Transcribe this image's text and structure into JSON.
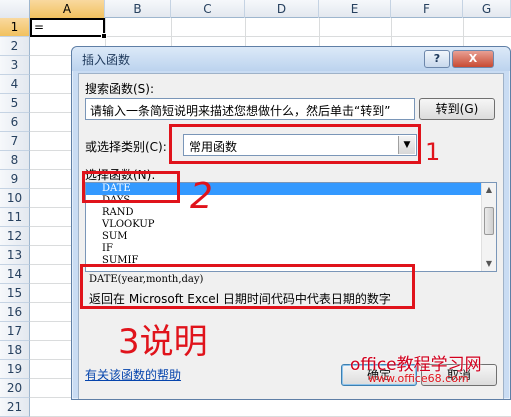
{
  "spreadsheet": {
    "columns": [
      "A",
      "B",
      "C",
      "D",
      "E",
      "F",
      "G"
    ],
    "rows": [
      "1",
      "2",
      "3",
      "4",
      "5",
      "6",
      "7",
      "8",
      "9",
      "10",
      "11",
      "12",
      "13",
      "14",
      "15",
      "16",
      "17",
      "18",
      "19",
      "20",
      "21"
    ],
    "active_cell_value": "="
  },
  "dialog": {
    "title": "插入函数",
    "help_button": "?",
    "close_button": "X",
    "search_label": "搜索函数(S):",
    "search_value": "请输入一条简短说明来描述您想做什么，然后单击“转到”",
    "goto_button": "转到(G)",
    "category_label": "或选择类别(C):",
    "category_value": "常用函数",
    "function_list_label": "选择函数(N):",
    "functions": [
      "DATE",
      "DAYS",
      "RAND",
      "VLOOKUP",
      "SUM",
      "IF",
      "SUMIF"
    ],
    "selected_function": "DATE",
    "signature": "DATE(year,month,day)",
    "description": "返回在 Microsoft Excel 日期时间代码中代表日期的数字",
    "help_link": "有关该函数的帮助",
    "ok_button": "确定",
    "cancel_button": "取消"
  },
  "annotations": {
    "mark1": "1",
    "mark2": "2",
    "mark3": "3说明"
  },
  "watermark": {
    "line1": "office教程学习网",
    "line2": "www.office68.com"
  },
  "colors": {
    "annotation_red": "#e0131b",
    "selection_blue": "#3399ff"
  }
}
